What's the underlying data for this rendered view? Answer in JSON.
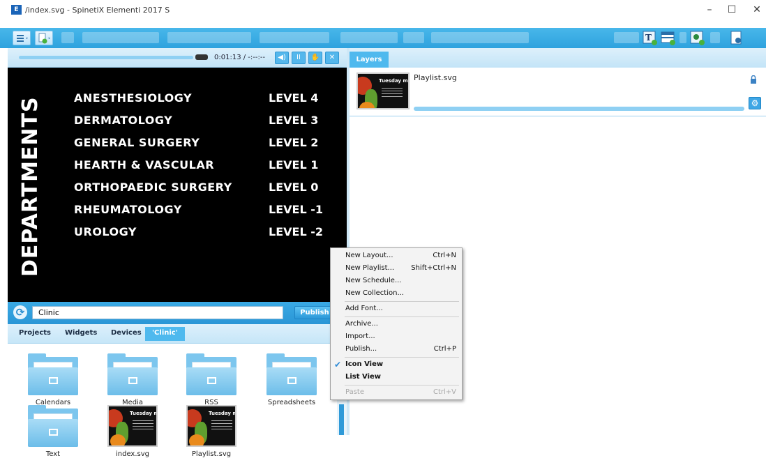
{
  "window": {
    "icon_text": "E",
    "title": "/index.svg - SpinetiX Elementi 2017 S",
    "minimize": "–",
    "maximize": "☐",
    "close": "✕"
  },
  "player": {
    "time": "0:01:13 / -:--:--",
    "buttons": {
      "volume": "◀)",
      "pause": "II",
      "hand": "✋",
      "close": "✕"
    }
  },
  "preview": {
    "heading": "DEPARTMENTS",
    "departments": [
      {
        "name": "ANESTHESIOLOGY",
        "level": "LEVEL 4"
      },
      {
        "name": "DERMATOLOGY",
        "level": "LEVEL 3"
      },
      {
        "name": "GENERAL SURGERY",
        "level": "LEVEL 2"
      },
      {
        "name": "HEARTH & VASCULAR",
        "level": "LEVEL 1"
      },
      {
        "name": "ORTHOPAEDIC SURGERY",
        "level": "LEVEL 0"
      },
      {
        "name": "RHEUMATOLOGY",
        "level": "LEVEL -1"
      },
      {
        "name": "UROLOGY",
        "level": "LEVEL -2"
      }
    ]
  },
  "search": {
    "value": "Clinic",
    "publish_label": "Publish",
    "refresh_glyph": "⟳"
  },
  "tabs": [
    "Projects",
    "Widgets",
    "Devices",
    "'Clinic'"
  ],
  "browser_items": [
    {
      "label": "Calendars",
      "type": "folder"
    },
    {
      "label": "Media",
      "type": "folder"
    },
    {
      "label": "RSS",
      "type": "folder"
    },
    {
      "label": "Spreadsheets",
      "type": "folder"
    },
    {
      "label": "Text",
      "type": "folder"
    },
    {
      "label": "index.svg",
      "type": "svg",
      "thumb_title": "Tuesday menu"
    },
    {
      "label": "Playlist.svg",
      "type": "svg",
      "thumb_title": "Tuesday men"
    }
  ],
  "layers": {
    "tab_label": "Layers",
    "item_name": "Playlist.svg",
    "thumb_title": "Tuesday men",
    "gear_glyph": "⚙"
  },
  "context_menu": {
    "items": [
      {
        "label": "New Layout...",
        "shortcut": "Ctrl+N"
      },
      {
        "label": "New Playlist...",
        "shortcut": "Shift+Ctrl+N"
      },
      {
        "label": "New Schedule...",
        "shortcut": ""
      },
      {
        "label": "New Collection...",
        "shortcut": ""
      },
      {
        "label": "Add Font...",
        "shortcut": ""
      },
      {
        "label": "Archive...",
        "shortcut": ""
      },
      {
        "label": "Import...",
        "shortcut": ""
      },
      {
        "label": "Publish...",
        "shortcut": "Ctrl+P"
      },
      {
        "label": "Icon View",
        "shortcut": "",
        "checked": true
      },
      {
        "label": "List View",
        "shortcut": ""
      },
      {
        "label": "Paste",
        "shortcut": "Ctrl+V",
        "disabled": true
      }
    ]
  },
  "colors": {
    "accent": "#2ea2de",
    "menu_bg": "#f3f3f3",
    "check": "#2d8ad6"
  }
}
